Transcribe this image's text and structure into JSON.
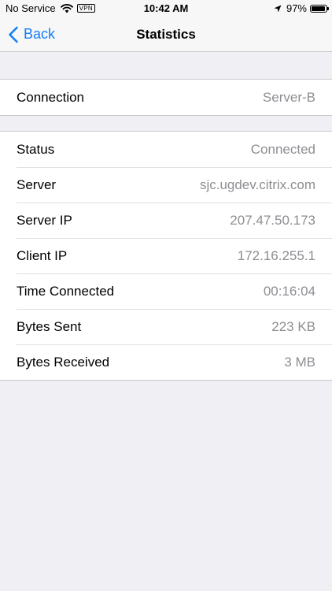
{
  "status_bar": {
    "carrier": "No Service",
    "vpn": "VPN",
    "time": "10:42 AM",
    "battery": "97%",
    "battery_level": 0.97
  },
  "nav": {
    "back_label": "Back",
    "title": "Statistics"
  },
  "connection_group": [
    {
      "label": "Connection",
      "value": "Server-B"
    }
  ],
  "details_group": [
    {
      "label": "Status",
      "value": "Connected"
    },
    {
      "label": "Server",
      "value": "sjc.ugdev.citrix.com"
    },
    {
      "label": "Server IP",
      "value": "207.47.50.173"
    },
    {
      "label": "Client IP",
      "value": "172.16.255.1"
    },
    {
      "label": "Time Connected",
      "value": "00:16:04"
    },
    {
      "label": "Bytes Sent",
      "value": "223 KB"
    },
    {
      "label": "Bytes Received",
      "value": "3 MB"
    }
  ],
  "colors": {
    "accent": "#157efb",
    "background": "#efeff4",
    "value_text": "#8e8e93"
  }
}
